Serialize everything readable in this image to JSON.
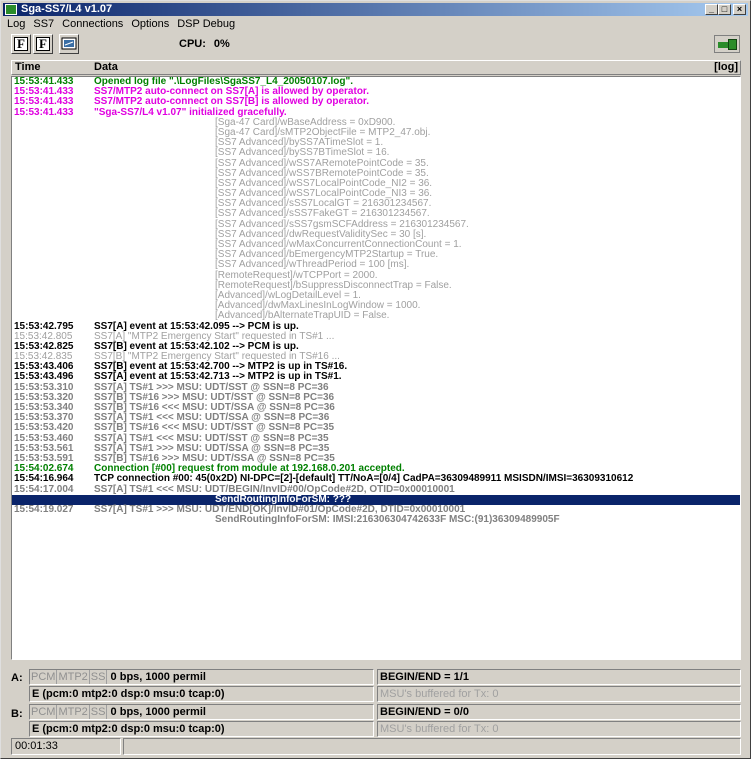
{
  "window": {
    "title": "Sga-SS7/L4  v1.07"
  },
  "window_buttons": [
    "_",
    "□",
    "×"
  ],
  "menu": [
    "Log",
    "SS7",
    "Connections",
    "Options",
    "DSP Debug"
  ],
  "toolbar": {
    "btn1": "F",
    "btn2": "F",
    "cpu_label": "CPU:",
    "cpu_value": "0%"
  },
  "log_header": {
    "time": "Time",
    "data": "Data",
    "right": "[log]"
  },
  "log_rows": [
    {
      "t": "15:53:41.433",
      "d": "Opened log file \".\\LogFiles\\SgaSS7_L4_20050107.log\".",
      "c": "green"
    },
    {
      "t": "15:53:41.433",
      "d": "SS7/MTP2 auto-connect on SS7[A] is allowed by operator.",
      "c": "magenta"
    },
    {
      "t": "15:53:41.433",
      "d": "SS7/MTP2 auto-connect on SS7[B] is allowed by operator.",
      "c": "magenta"
    },
    {
      "t": "15:53:41.433",
      "d": "\"Sga-SS7/L4  v1.07\" initialized gracefully.",
      "c": "magenta"
    },
    {
      "t": "",
      "d": "[Sga-47 Card]/wBaseAddress = 0xD900.",
      "c": "gray",
      "indent": true
    },
    {
      "t": "",
      "d": "[Sga-47 Card]/sMTP2ObjectFile = MTP2_47.obj.",
      "c": "gray",
      "indent": true
    },
    {
      "t": "",
      "d": "[SS7 Advanced]/bySS7ATimeSlot = 1.",
      "c": "gray",
      "indent": true
    },
    {
      "t": "",
      "d": "[SS7 Advanced]/bySS7BTimeSlot = 16.",
      "c": "gray",
      "indent": true
    },
    {
      "t": "",
      "d": "[SS7 Advanced]/wSS7ARemotePointCode = 35.",
      "c": "gray",
      "indent": true
    },
    {
      "t": "",
      "d": "[SS7 Advanced]/wSS7BRemotePointCode = 35.",
      "c": "gray",
      "indent": true
    },
    {
      "t": "",
      "d": "[SS7 Advanced]/wSS7LocalPointCode_NI2 = 36.",
      "c": "gray",
      "indent": true
    },
    {
      "t": "",
      "d": "[SS7 Advanced]/wSS7LocalPointCode_NI3 = 36.",
      "c": "gray",
      "indent": true
    },
    {
      "t": "",
      "d": "[SS7 Advanced]/sSS7LocalGT = 216301234567.",
      "c": "gray",
      "indent": true
    },
    {
      "t": "",
      "d": "[SS7 Advanced]/sSS7FakeGT = 216301234567.",
      "c": "gray",
      "indent": true
    },
    {
      "t": "",
      "d": "[SS7 Advanced]/sSS7gsmSCFAddress = 216301234567.",
      "c": "gray",
      "indent": true
    },
    {
      "t": "",
      "d": "[SS7 Advanced]/dwRequestValiditySec = 30 [s].",
      "c": "gray",
      "indent": true
    },
    {
      "t": "",
      "d": "[SS7 Advanced]/wMaxConcurrentConnectionCount = 1.",
      "c": "gray",
      "indent": true
    },
    {
      "t": "",
      "d": "[SS7 Advanced]/bEmergencyMTP2Startup = True.",
      "c": "gray",
      "indent": true
    },
    {
      "t": "",
      "d": "[SS7 Advanced]/wThreadPeriod = 100 [ms].",
      "c": "gray",
      "indent": true
    },
    {
      "t": "",
      "d": "[RemoteRequest]/wTCPPort = 2000.",
      "c": "gray",
      "indent": true
    },
    {
      "t": "",
      "d": "[RemoteRequest]/bSuppressDisconnectTrap = False.",
      "c": "gray",
      "indent": true
    },
    {
      "t": "",
      "d": "[Advanced]/wLogDetailLevel = 1.",
      "c": "gray",
      "indent": true
    },
    {
      "t": "",
      "d": "[Advanced]/dwMaxLinesInLogWindow = 1000.",
      "c": "gray",
      "indent": true
    },
    {
      "t": "",
      "d": "[Advanced]/bAlternateTrapUID = False.",
      "c": "gray",
      "indent": true
    },
    {
      "t": "15:53:42.795",
      "d": "SS7[A] event at 15:53:42.095 --> PCM is up.",
      "c": "black"
    },
    {
      "t": "15:53:42.805",
      "d": "SS7[A] \"MTP2 Emergency Start\" requested in TS#1 ...",
      "c": "gray"
    },
    {
      "t": "15:53:42.825",
      "d": "SS7[B] event at 15:53:42.102 --> PCM is up.",
      "c": "black"
    },
    {
      "t": "15:53:42.835",
      "d": "SS7[B] \"MTP2 Emergency Start\" requested in TS#16 ...",
      "c": "gray"
    },
    {
      "t": "15:53:43.406",
      "d": "SS7[B] event at 15:53:42.700 --> MTP2 is up in TS#16.",
      "c": "black"
    },
    {
      "t": "15:53:43.496",
      "d": "SS7[A] event at 15:53:42.713 --> MTP2 is up in TS#1.",
      "c": "black"
    },
    {
      "t": "15:53:53.310",
      "d": "SS7[A] TS#1 >>> MSU:  UDT/SST @ SSN=8 PC=36",
      "c": "darkgray"
    },
    {
      "t": "15:53:53.320",
      "d": "SS7[B] TS#16 >>> MSU:  UDT/SST @ SSN=8 PC=36",
      "c": "darkgray"
    },
    {
      "t": "15:53:53.340",
      "d": "SS7[B] TS#16 <<< MSU:  UDT/SSA @ SSN=8 PC=36",
      "c": "darkgray"
    },
    {
      "t": "15:53:53.370",
      "d": "SS7[A] TS#1 <<< MSU:  UDT/SSA @ SSN=8 PC=36",
      "c": "darkgray"
    },
    {
      "t": "15:53:53.420",
      "d": "SS7[B] TS#16 <<< MSU:  UDT/SST @ SSN=8 PC=35",
      "c": "darkgray"
    },
    {
      "t": "15:53:53.460",
      "d": "SS7[A] TS#1 <<< MSU:  UDT/SST @ SSN=8 PC=35",
      "c": "darkgray"
    },
    {
      "t": "15:53:53.561",
      "d": "SS7[A] TS#1 >>> MSU:  UDT/SSA @ SSN=8 PC=35",
      "c": "darkgray"
    },
    {
      "t": "15:53:53.591",
      "d": "SS7[B] TS#16 >>> MSU:  UDT/SSA @ SSN=8 PC=35",
      "c": "darkgray"
    },
    {
      "t": "15:54:02.674",
      "d": "Connection [#00] request from module at 192.168.0.201 accepted.",
      "c": "green"
    },
    {
      "t": "15:54:16.964",
      "d": "TCP connection #00:  45(0x2D) NI-DPC=[2]-[default] TT/NoA=[0/4] CadPA=36309489911 MSISDN/IMSI=36309310612",
      "c": "black"
    },
    {
      "t": "15:54:17.004",
      "d": "SS7[A] TS#1 <<< MSU:  UDT/BEGIN/InvID#00/OpCode#2D, OTID=0x00010001",
      "c": "darkgray"
    },
    {
      "t": "",
      "d": "SendRoutingInfoForSM: ???",
      "c": "sel",
      "indent": true
    },
    {
      "t": "15:54:19.027",
      "d": "SS7[A] TS#1 >>> MSU:  UDT/END[OK]/InvID#01/OpCode#2D, DTID=0x00010001",
      "c": "darkgray"
    },
    {
      "t": "",
      "d": "SendRoutingInfoForSM: IMSI:216306304742633F MSC:(91)36309489905F",
      "c": "darkgray",
      "indent": true
    }
  ],
  "status": {
    "a": {
      "label": "A:",
      "badges": [
        "PCM",
        "MTP2",
        "SS"
      ],
      "rate": "0 bps, 1000 permil",
      "stats": "E (pcm:0  mtp2:0  dsp:0  msu:0  tcap:0)",
      "begin_end": "BEGIN/END = 1/1",
      "buffered": "MSU's buffered for Tx: 0"
    },
    "b": {
      "label": "B:",
      "badges": [
        "PCM",
        "MTP2",
        "SS"
      ],
      "rate": "0 bps, 1000 permil",
      "stats": "E (pcm:0  mtp2:0  dsp:0  msu:0  tcap:0)",
      "begin_end": "BEGIN/END = 0/0",
      "buffered": "MSU's buffered for Tx: 0"
    },
    "elapsed": "00:01:33"
  }
}
